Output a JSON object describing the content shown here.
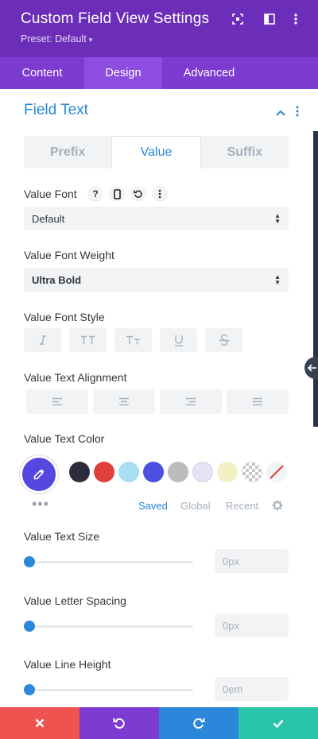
{
  "header": {
    "title": "Custom Field View Settings",
    "preset": "Preset: Default",
    "preset_caret": "▾",
    "bg_color": "#6c2eb9"
  },
  "tabs": [
    {
      "label": "Content",
      "active": false
    },
    {
      "label": "Design",
      "active": true
    },
    {
      "label": "Advanced",
      "active": false
    }
  ],
  "section": {
    "title": "Field Text",
    "subtabs": [
      {
        "label": "Prefix",
        "active": false
      },
      {
        "label": "Value",
        "active": true
      },
      {
        "label": "Suffix",
        "active": false
      }
    ]
  },
  "value_font": {
    "label": "Value Font",
    "help_glyph": "?",
    "value": "Default"
  },
  "value_font_weight": {
    "label": "Value Font Weight",
    "value": "Ultra Bold"
  },
  "value_font_style": {
    "label": "Value Font Style",
    "buttons": [
      "italic",
      "uppercase",
      "small-caps",
      "underline",
      "strikethrough"
    ]
  },
  "value_text_alignment": {
    "label": "Value Text Alignment",
    "buttons": [
      "left",
      "center",
      "right",
      "justify"
    ]
  },
  "value_text_color": {
    "label": "Value Text Color",
    "selected_color": "#5546e0",
    "swatches": [
      "#2b2d3c",
      "#e0403a",
      "#a8dff0",
      "#4a50e0",
      "#bcbcbc",
      "#e4e4f4",
      "#f3efc5",
      "checkered",
      "none"
    ],
    "more_glyph": "•••",
    "color_tabs": {
      "saved": "Saved",
      "global": "Global",
      "recent": "Recent"
    }
  },
  "value_text_size": {
    "label": "Value Text Size",
    "value": "0px",
    "slider_fraction": 0
  },
  "value_letter_spacing": {
    "label": "Value Letter Spacing",
    "value": "0px",
    "slider_fraction": 0
  },
  "value_line_height": {
    "label": "Value Line Height",
    "value": "0em",
    "slider_fraction": 0
  },
  "bottom_bar": [
    {
      "action": "cancel",
      "color": "#ef5350"
    },
    {
      "action": "undo",
      "color": "#7d3bd1"
    },
    {
      "action": "redo",
      "color": "#2b87da"
    },
    {
      "action": "save",
      "color": "#29c4a9"
    }
  ]
}
